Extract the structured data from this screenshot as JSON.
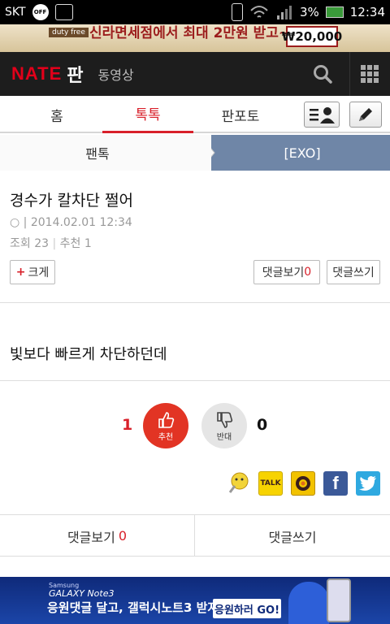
{
  "status_bar": {
    "carrier": "SKT",
    "battery": "3%",
    "time": "12:34"
  },
  "top_ad": {
    "tag": "duty free",
    "text": "신라면세점에서 최대 2만원 받고~",
    "price": "₩20,000"
  },
  "header": {
    "logo": "NATE",
    "section": "판",
    "video": "동영상"
  },
  "tabs": [
    {
      "label": "홈"
    },
    {
      "label": "톡톡"
    },
    {
      "label": "판포토"
    }
  ],
  "subtabs": {
    "left": "팬톡",
    "right": "[EXO]"
  },
  "article": {
    "title": "경수가 칼차단 쩔어",
    "author_mark": "○ |",
    "date": "2014.02.01 12:34",
    "views_label": "조회",
    "views": "23",
    "recommend_label": "추천",
    "recommend": "1",
    "body": "빛보다 빠르게 차단하던데"
  },
  "buttons": {
    "enlarge": "크게",
    "view_comments": "댓글보기",
    "comment_count": "0",
    "write_comment": "댓글쓰기"
  },
  "votes": {
    "up_count": "1",
    "up_label": "추천",
    "down_count": "0",
    "down_label": "반대"
  },
  "share": {
    "kakao_talk": "TALK",
    "facebook": "f"
  },
  "bottom_bar": {
    "view_comments": "댓글보기",
    "comment_count": "0",
    "write_comment": "댓글쓰기"
  },
  "bottom_ad": {
    "brand_small": "Samsung",
    "brand": "GALAXY Note3",
    "text": "응원댓글 달고, 갤럭시노트3 받자",
    "cta": "응원하러 GO!"
  },
  "colors": {
    "accent": "#d8202a",
    "header_bg": "#1d1d1d",
    "subtab_active": "#6f86a7"
  }
}
